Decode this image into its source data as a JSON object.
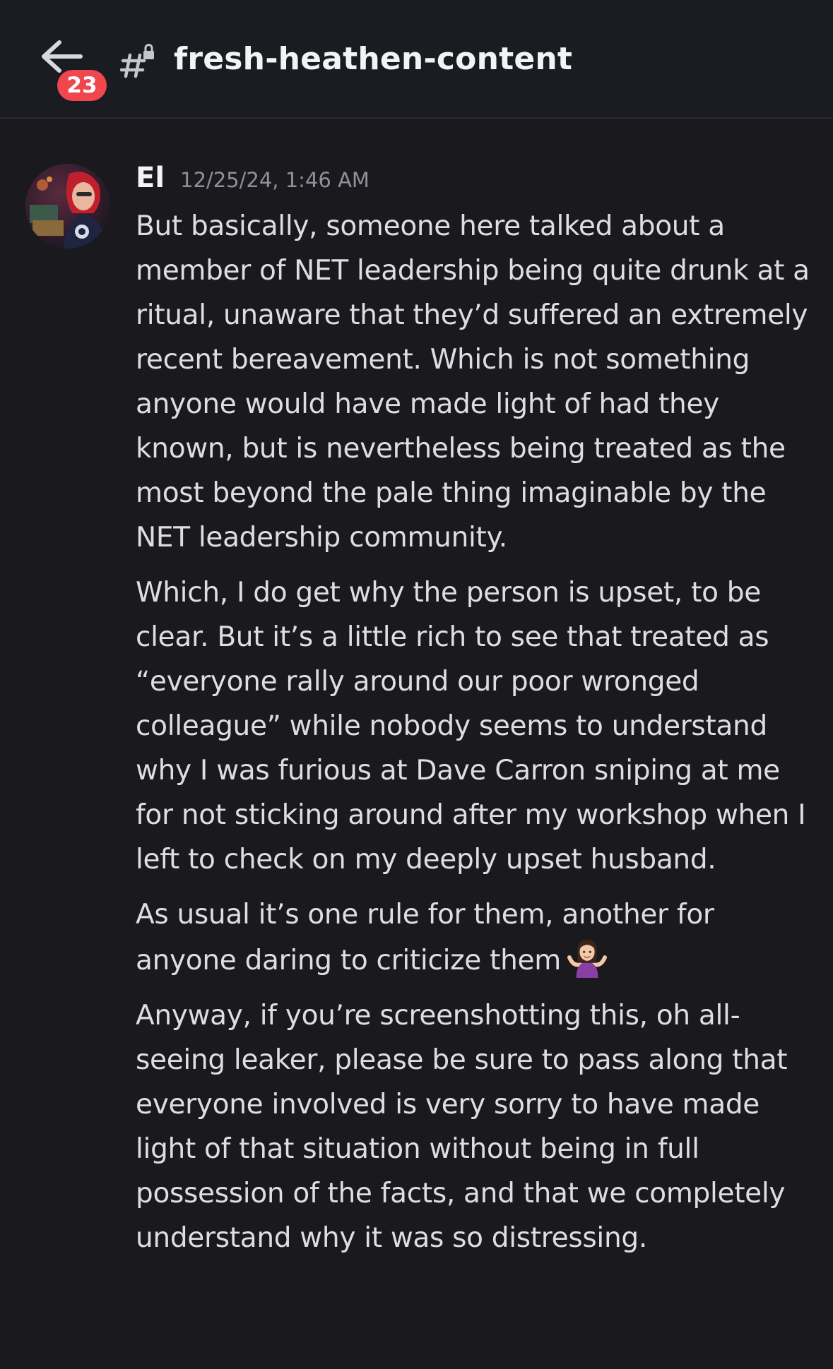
{
  "header": {
    "unread_badge": "23",
    "channel_name": "fresh-heathen-content",
    "back_icon": "arrow-left-icon",
    "channel_icon": "locked-text-channel-icon"
  },
  "message": {
    "author": "El",
    "timestamp": "12/25/24, 1:46 AM",
    "paragraphs": [
      "But basically, someone here talked about a member of NET leadership being quite drunk at a ritual, unaware that they’d suffered an extremely recent bereavement. Which is not something anyone would have made light of had they known, but is nevertheless being treated as the most beyond the pale thing imaginable by the NET leadership community.",
      "Which, I do get why the person is upset, to be clear. But it’s a little rich to see that treated as “everyone rally around our poor wronged colleague” while nobody seems to understand why I was furious at Dave Carron sniping at me for not sticking around after my workshop when I left to check on my deeply upset husband.",
      "As usual it’s one rule for them, another for anyone daring to criticize them",
      "Anyway, if you’re screenshotting this, oh all-seeing leaker, please be sure to pass along that everyone involved is very sorry to have made light of that situation without being in full possession of the facts, and that we completely understand why it was so distressing."
    ],
    "emoji": "woman-shrugging-emoji"
  },
  "colors": {
    "background": "#1a1a1e",
    "header_background": "#1b1c21",
    "badge": "#f0464e",
    "text": "#dcdee3",
    "muted": "#8e9199"
  }
}
